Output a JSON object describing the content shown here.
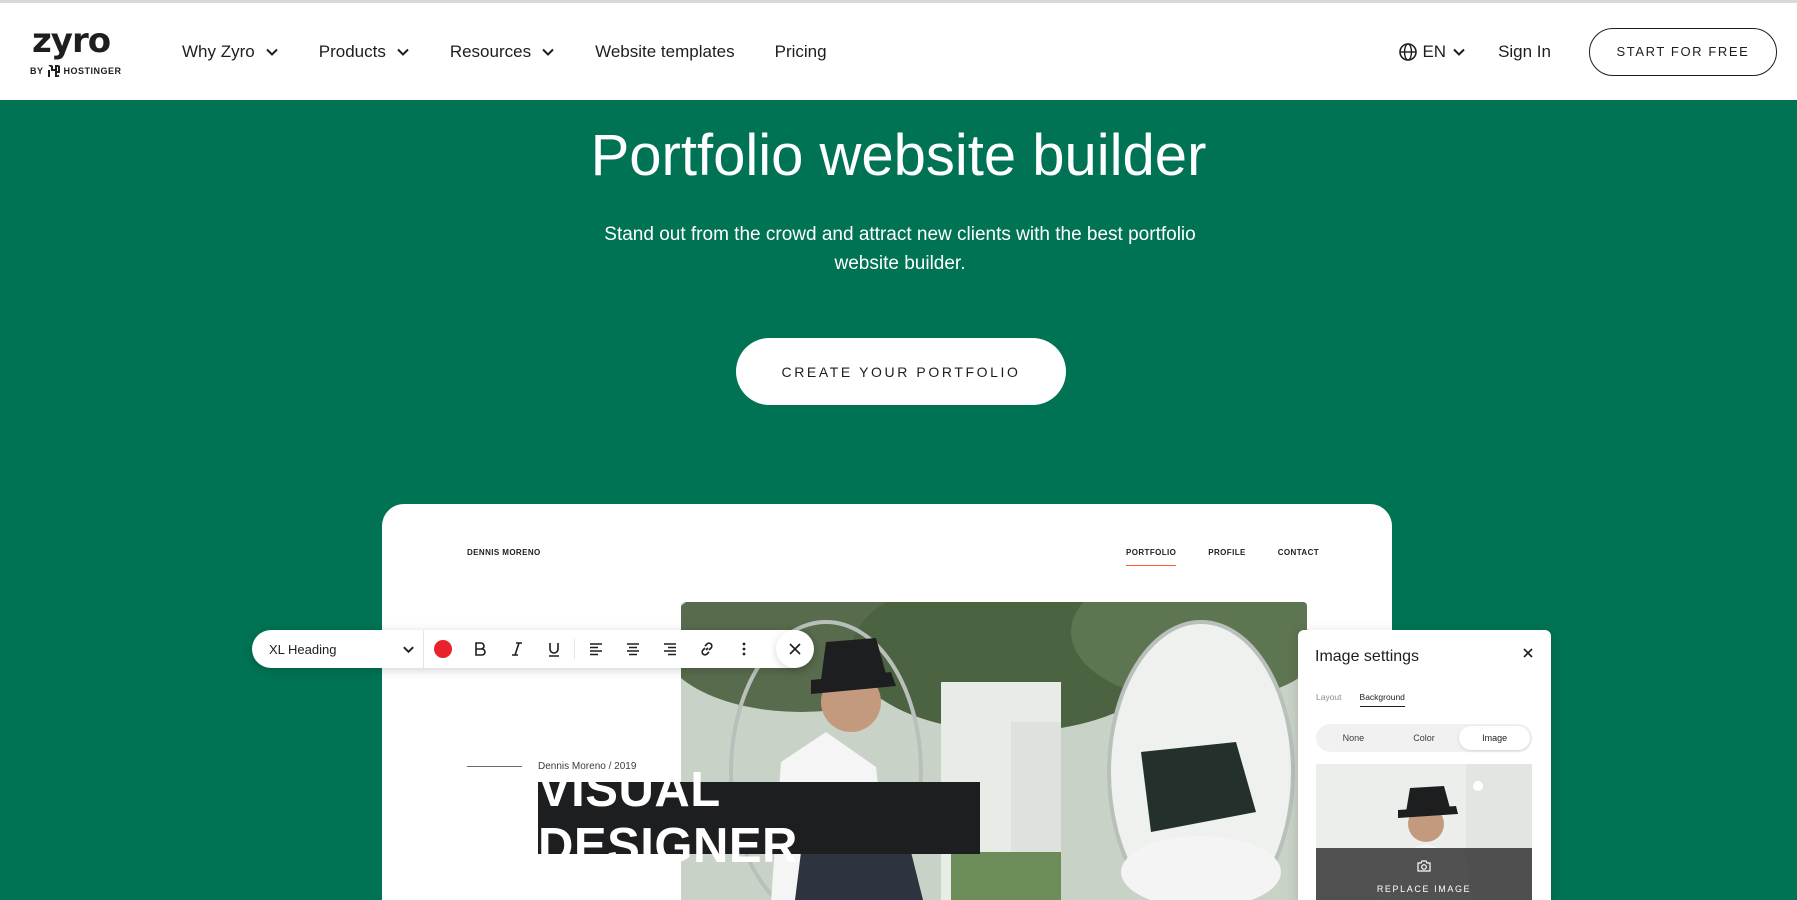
{
  "header": {
    "logo_word": "zyro",
    "logo_by": "BY",
    "logo_brand": "HOSTINGER",
    "nav": [
      {
        "label": "Why Zyro",
        "dropdown": true
      },
      {
        "label": "Products",
        "dropdown": true
      },
      {
        "label": "Resources",
        "dropdown": true
      },
      {
        "label": "Website templates",
        "dropdown": false
      },
      {
        "label": "Pricing",
        "dropdown": false
      }
    ],
    "language": "EN",
    "sign_in": "Sign In",
    "start_button": "START FOR FREE"
  },
  "hero": {
    "title": "Portfolio website builder",
    "subtitle": "Stand out from the crowd and attract new clients with the best portfolio website builder.",
    "cta": "CREATE YOUR PORTFOLIO",
    "background_color": "#007354"
  },
  "mockup": {
    "site_name": "DENNIS MORENO",
    "site_nav": [
      "PORTFOLIO",
      "PROFILE",
      "CONTACT"
    ],
    "active_nav": "PORTFOLIO",
    "meta": "Dennis Moreno / 2019",
    "heading": "VISUAL DESIGNER",
    "toolbar": {
      "style_select": "XL Heading",
      "color": "#e8222b",
      "buttons": [
        "bold-icon",
        "italic-icon",
        "underline-icon",
        "align-left-icon",
        "align-center-icon",
        "align-right-icon",
        "link-icon",
        "more-icon"
      ]
    },
    "image_settings": {
      "title": "Image settings",
      "tabs": [
        "Layout",
        "Background"
      ],
      "active_tab": "Background",
      "options": [
        "None",
        "Color",
        "Image"
      ],
      "active_option": "Image",
      "replace_label": "REPLACE IMAGE"
    }
  }
}
